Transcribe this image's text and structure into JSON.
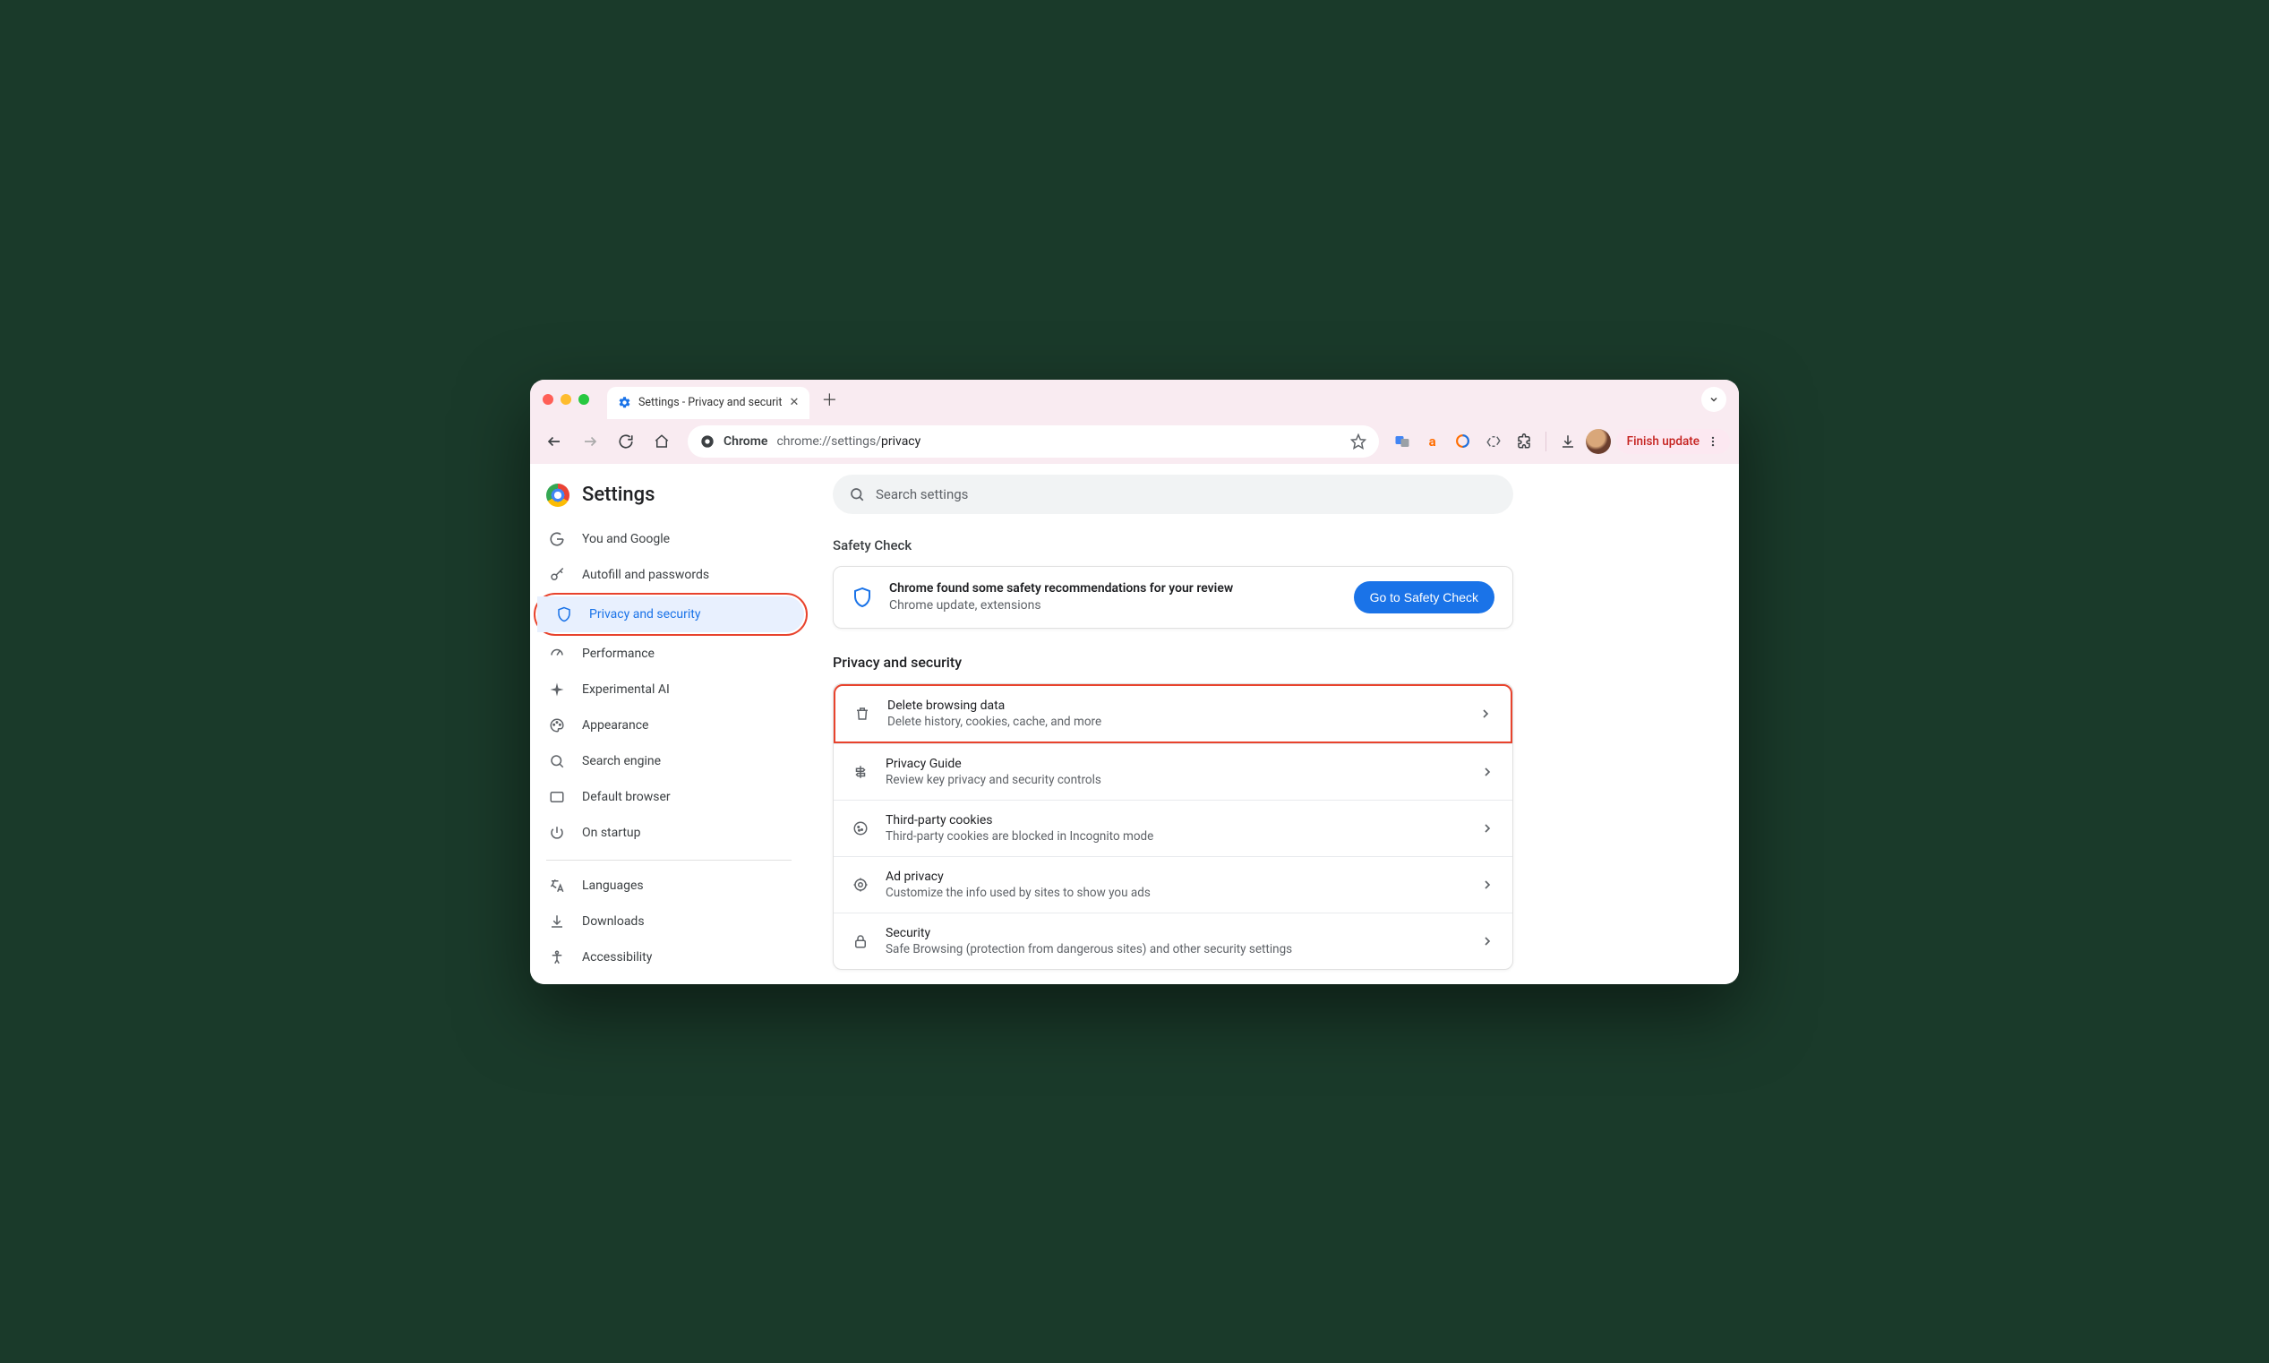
{
  "tab": {
    "title": "Settings - Privacy and securit"
  },
  "omnibox": {
    "chrome_label": "Chrome",
    "url_prefix": "chrome://settings/",
    "url_suffix": "privacy"
  },
  "toolbar": {
    "finish_update": "Finish update"
  },
  "settings": {
    "header": "Settings",
    "search_placeholder": "Search settings"
  },
  "nav": {
    "you_and_google": "You and Google",
    "autofill": "Autofill and passwords",
    "privacy": "Privacy and security",
    "performance": "Performance",
    "experimental_ai": "Experimental AI",
    "appearance": "Appearance",
    "search_engine": "Search engine",
    "default_browser": "Default browser",
    "on_startup": "On startup",
    "languages": "Languages",
    "downloads": "Downloads",
    "accessibility": "Accessibility"
  },
  "safety_check": {
    "label": "Safety Check",
    "title": "Chrome found some safety recommendations for your review",
    "subtitle": "Chrome update, extensions",
    "button": "Go to Safety Check"
  },
  "privacy_section": {
    "label": "Privacy and security",
    "rows": [
      {
        "title": "Delete browsing data",
        "subtitle": "Delete history, cookies, cache, and more"
      },
      {
        "title": "Privacy Guide",
        "subtitle": "Review key privacy and security controls"
      },
      {
        "title": "Third-party cookies",
        "subtitle": "Third-party cookies are blocked in Incognito mode"
      },
      {
        "title": "Ad privacy",
        "subtitle": "Customize the info used by sites to show you ads"
      },
      {
        "title": "Security",
        "subtitle": "Safe Browsing (protection from dangerous sites) and other security settings"
      }
    ]
  }
}
